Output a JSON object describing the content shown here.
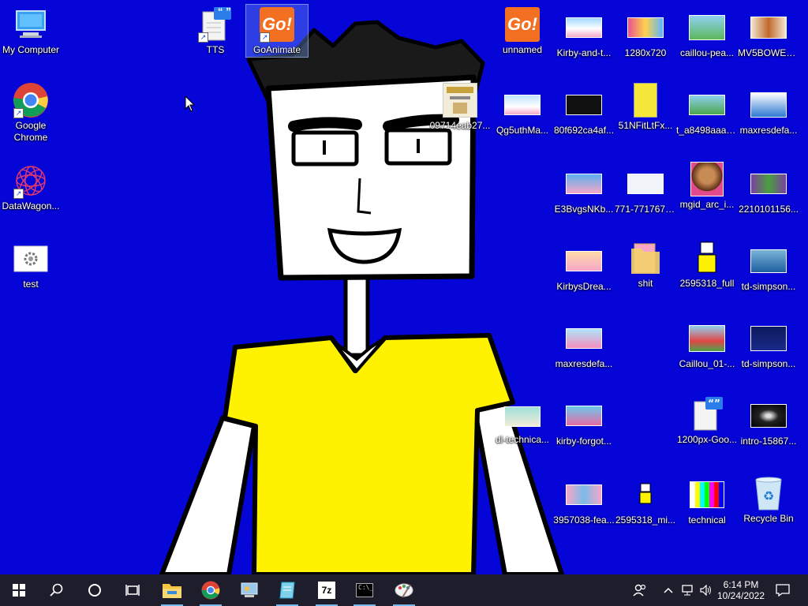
{
  "desktop": {
    "icons": [
      {
        "label": "My Computer"
      },
      {
        "label": "Google Chrome"
      },
      {
        "label": "DataWagon..."
      },
      {
        "label": "test"
      },
      {
        "label": "TTS"
      },
      {
        "label": "GoAnimate"
      },
      {
        "label": "09714eab27..."
      },
      {
        "label": "unnamed"
      },
      {
        "label": "Qg5uthMa..."
      },
      {
        "label": "Kirby-and-t..."
      },
      {
        "label": "80f692ca4af..."
      },
      {
        "label": "E3BvgsNKb..."
      },
      {
        "label": "KirbysDrea..."
      },
      {
        "label": "maxresdefa..."
      },
      {
        "label": "kirby-forgot..."
      },
      {
        "label": "3957038-fea..."
      },
      {
        "label": "1280x720"
      },
      {
        "label": "51NFitLtFx..."
      },
      {
        "label": "771-7717675..."
      },
      {
        "label": "shit"
      },
      {
        "label": "2595318_mi..."
      },
      {
        "label": "caillou-pea..."
      },
      {
        "label": "t_a8498aaaa..."
      },
      {
        "label": "mgid_arc_i..."
      },
      {
        "label": "2595318_full"
      },
      {
        "label": "Caillou_01-..."
      },
      {
        "label": "1200px-Goo..."
      },
      {
        "label": "technical"
      },
      {
        "label": "MV5BOWE1..."
      },
      {
        "label": "maxresdefa..."
      },
      {
        "label": "2210101156..."
      },
      {
        "label": "td-simpson..."
      },
      {
        "label": "td-simpson..."
      },
      {
        "label": "intro-15867..."
      },
      {
        "label": "Recycle Bin"
      },
      {
        "label": "dl-technica..."
      }
    ],
    "goanimate_logo_text": "Go!",
    "tts_badge_text": "“ ”"
  },
  "taskbar": {
    "start_icon": "windows-logo-icon",
    "search_icon": "search-icon",
    "cortana_icon": "cortana-circle-icon",
    "taskview_icon": "task-view-icon",
    "pinned": [
      "file-explorer-icon",
      "chrome-icon",
      "control-panel-icon",
      "notepad-icon",
      "7zip-icon",
      "command-prompt-icon",
      "paint-icon"
    ],
    "sevenzip_text": "7z",
    "cmd_text": "C:\\_",
    "time": "6:14 PM",
    "date": "10/24/2022"
  },
  "colors": {
    "desktop_bg": "#0505d8",
    "shirt": "#fff200",
    "taskbar": "#1d1d2b",
    "accent": "#76b9ed"
  }
}
